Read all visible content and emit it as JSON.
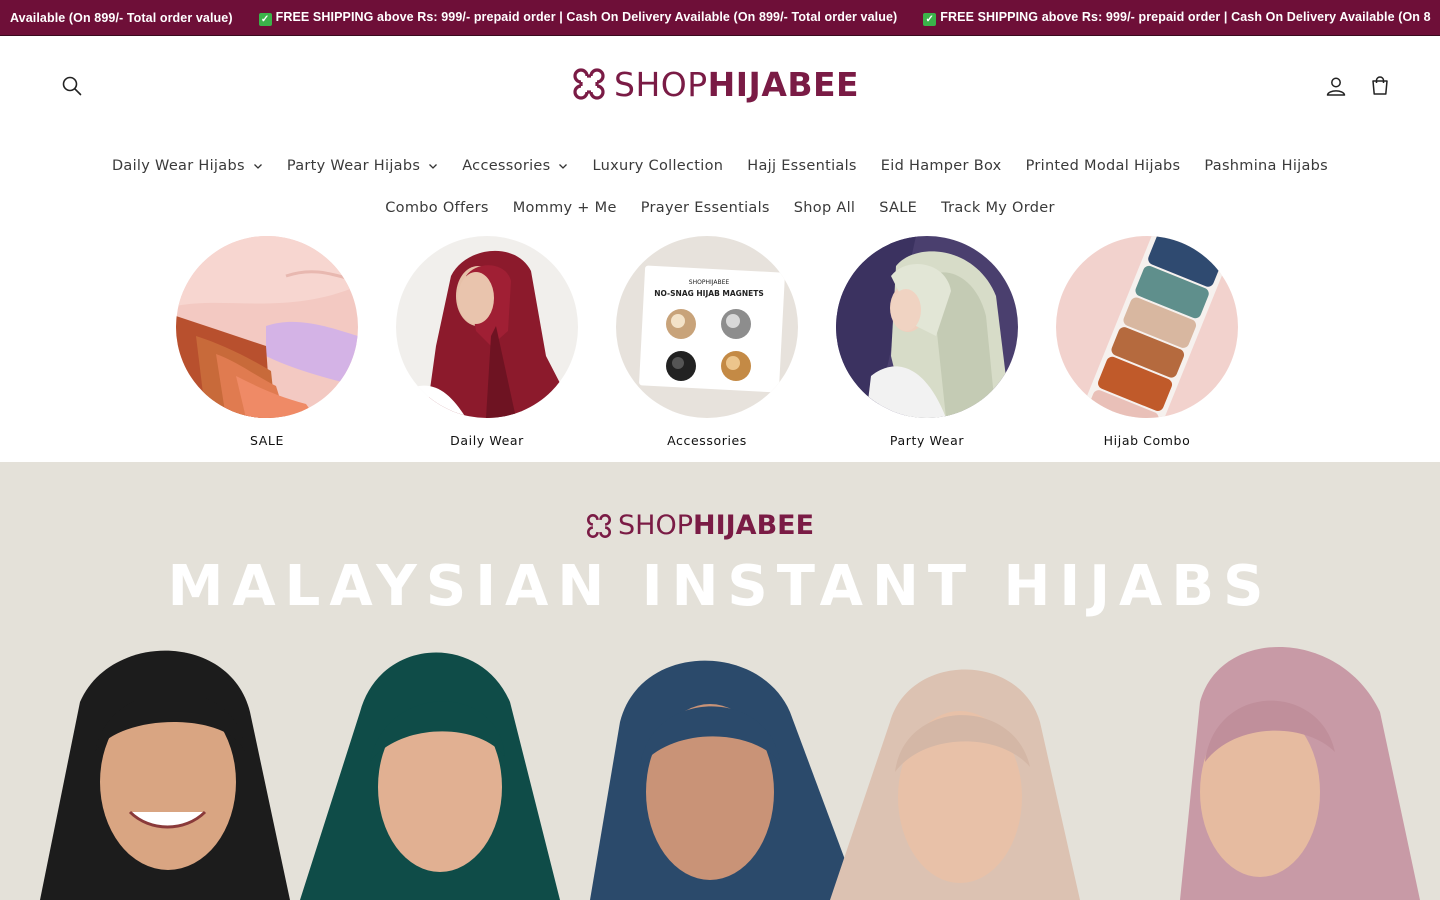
{
  "announcement": {
    "items": [
      "Available (On 899/- Total order value)",
      "FREE SHIPPING above Rs: 999/- prepaid order | Cash On Delivery Available (On 899/- Total order value)",
      "FREE SHIPPING above Rs: 999/- prepaid order | Cash On Delivery Available (On 8"
    ],
    "colors": {
      "background": "#6e0f38",
      "text": "#ffffff"
    }
  },
  "header": {
    "logo": {
      "light": "SHOP",
      "bold": "HIJABEE"
    },
    "icons": [
      "search-icon",
      "account-icon",
      "cart-icon"
    ]
  },
  "nav": {
    "row1": [
      {
        "label": "Daily Wear Hijabs",
        "dropdown": true
      },
      {
        "label": "Party Wear Hijabs",
        "dropdown": true
      },
      {
        "label": "Accessories",
        "dropdown": true
      },
      {
        "label": "Luxury Collection",
        "dropdown": false
      },
      {
        "label": "Hajj Essentials",
        "dropdown": false
      },
      {
        "label": "Eid Hamper Box",
        "dropdown": false
      },
      {
        "label": "Printed Modal Hijabs",
        "dropdown": false
      },
      {
        "label": "Pashmina Hijabs",
        "dropdown": false
      }
    ],
    "row2": [
      {
        "label": "Combo Offers"
      },
      {
        "label": "Mommy + Me"
      },
      {
        "label": "Prayer Essentials"
      },
      {
        "label": "Shop All"
      },
      {
        "label": "SALE"
      },
      {
        "label": "Track My Order"
      }
    ]
  },
  "categories": [
    {
      "label": "SALE"
    },
    {
      "label": "Daily Wear"
    },
    {
      "label": "Accessories",
      "image_text": {
        "brand": "SHOPHIJABEE",
        "title": "NO-SNAG HIJAB MAGNETS"
      }
    },
    {
      "label": "Party Wear"
    },
    {
      "label": "Hijab Combo"
    }
  ],
  "hero": {
    "logo": {
      "light": "SHOP",
      "bold": "HIJABEE"
    },
    "title": "MALAYSIAN INSTANT HIJABS",
    "background": "#e4e1d9",
    "brand_color": "#7a1b45"
  }
}
